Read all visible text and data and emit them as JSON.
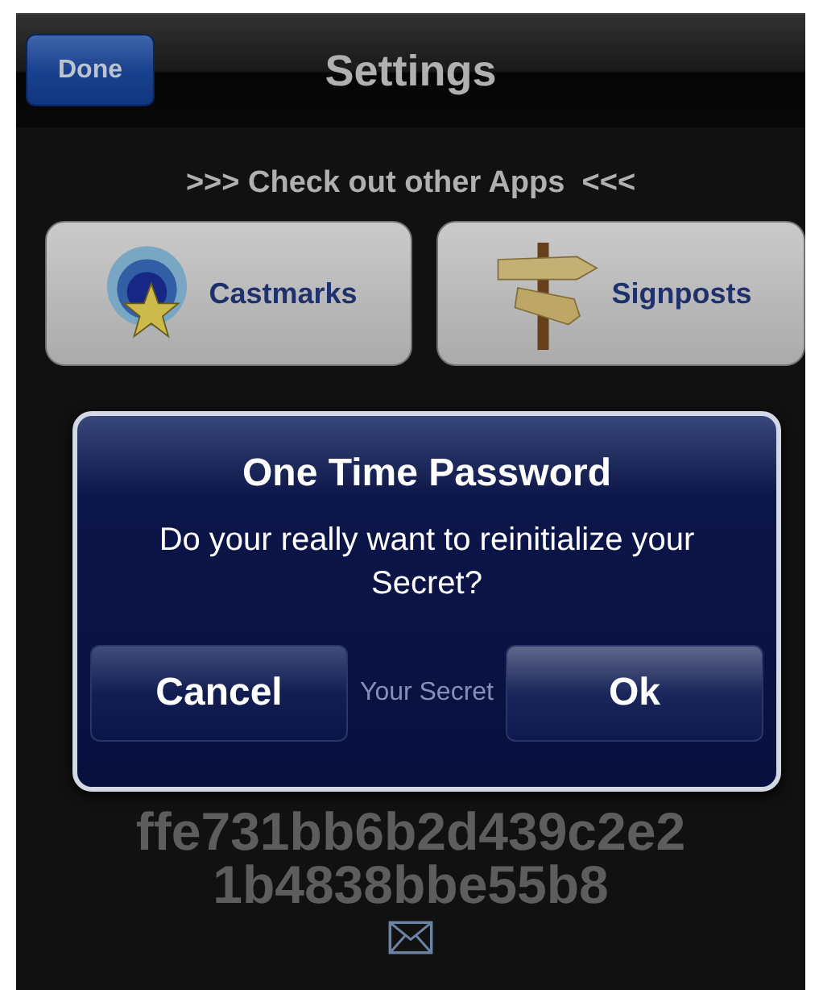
{
  "nav": {
    "done_button": "Done",
    "title": "Settings"
  },
  "promo": {
    "heading": ">>> Check out other Apps  <<<",
    "apps": [
      {
        "name": "Castmarks",
        "kind": "star"
      },
      {
        "name": "Signposts",
        "kind": "signpost"
      }
    ]
  },
  "secret": {
    "label": "Your Secret",
    "lines": [
      "ffe731bb6b2d439c2e2",
      "1b4838bbe55b8"
    ]
  },
  "alert": {
    "title": "One Time Password",
    "message": "Do your really want to reinitialize your Secret?",
    "buttons": [
      "Cancel",
      "Ok"
    ]
  }
}
